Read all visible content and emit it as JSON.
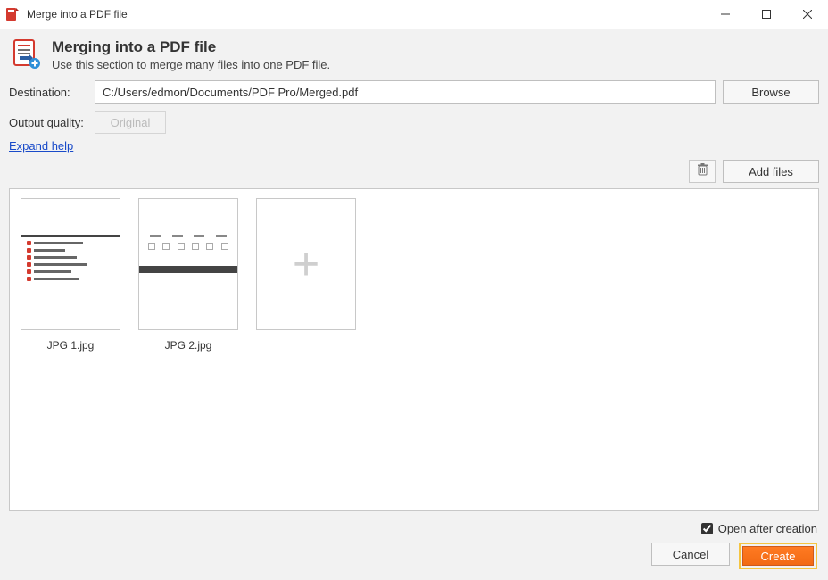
{
  "window": {
    "title": "Merge into a PDF file"
  },
  "header": {
    "title": "Merging into a PDF file",
    "subtitle": "Use this section to merge many files into one PDF file."
  },
  "form": {
    "destination_label": "Destination:",
    "destination_value": "C:/Users/edmon/Documents/PDF Pro/Merged.pdf",
    "browse_label": "Browse",
    "quality_label": "Output quality:",
    "quality_value": "Original",
    "expand_help": "Expand help"
  },
  "toolbar": {
    "add_files_label": "Add files"
  },
  "files": [
    {
      "name": "JPG 1.jpg"
    },
    {
      "name": "JPG 2.jpg"
    }
  ],
  "options": {
    "open_after_label": "Open after creation",
    "open_after_checked": true
  },
  "buttons": {
    "cancel": "Cancel",
    "create": "Create"
  },
  "colors": {
    "accent_orange": "#f26a14",
    "highlight_yellow": "#f5c542",
    "link_blue": "#1a4bc9",
    "pdf_red": "#d43a2f"
  }
}
